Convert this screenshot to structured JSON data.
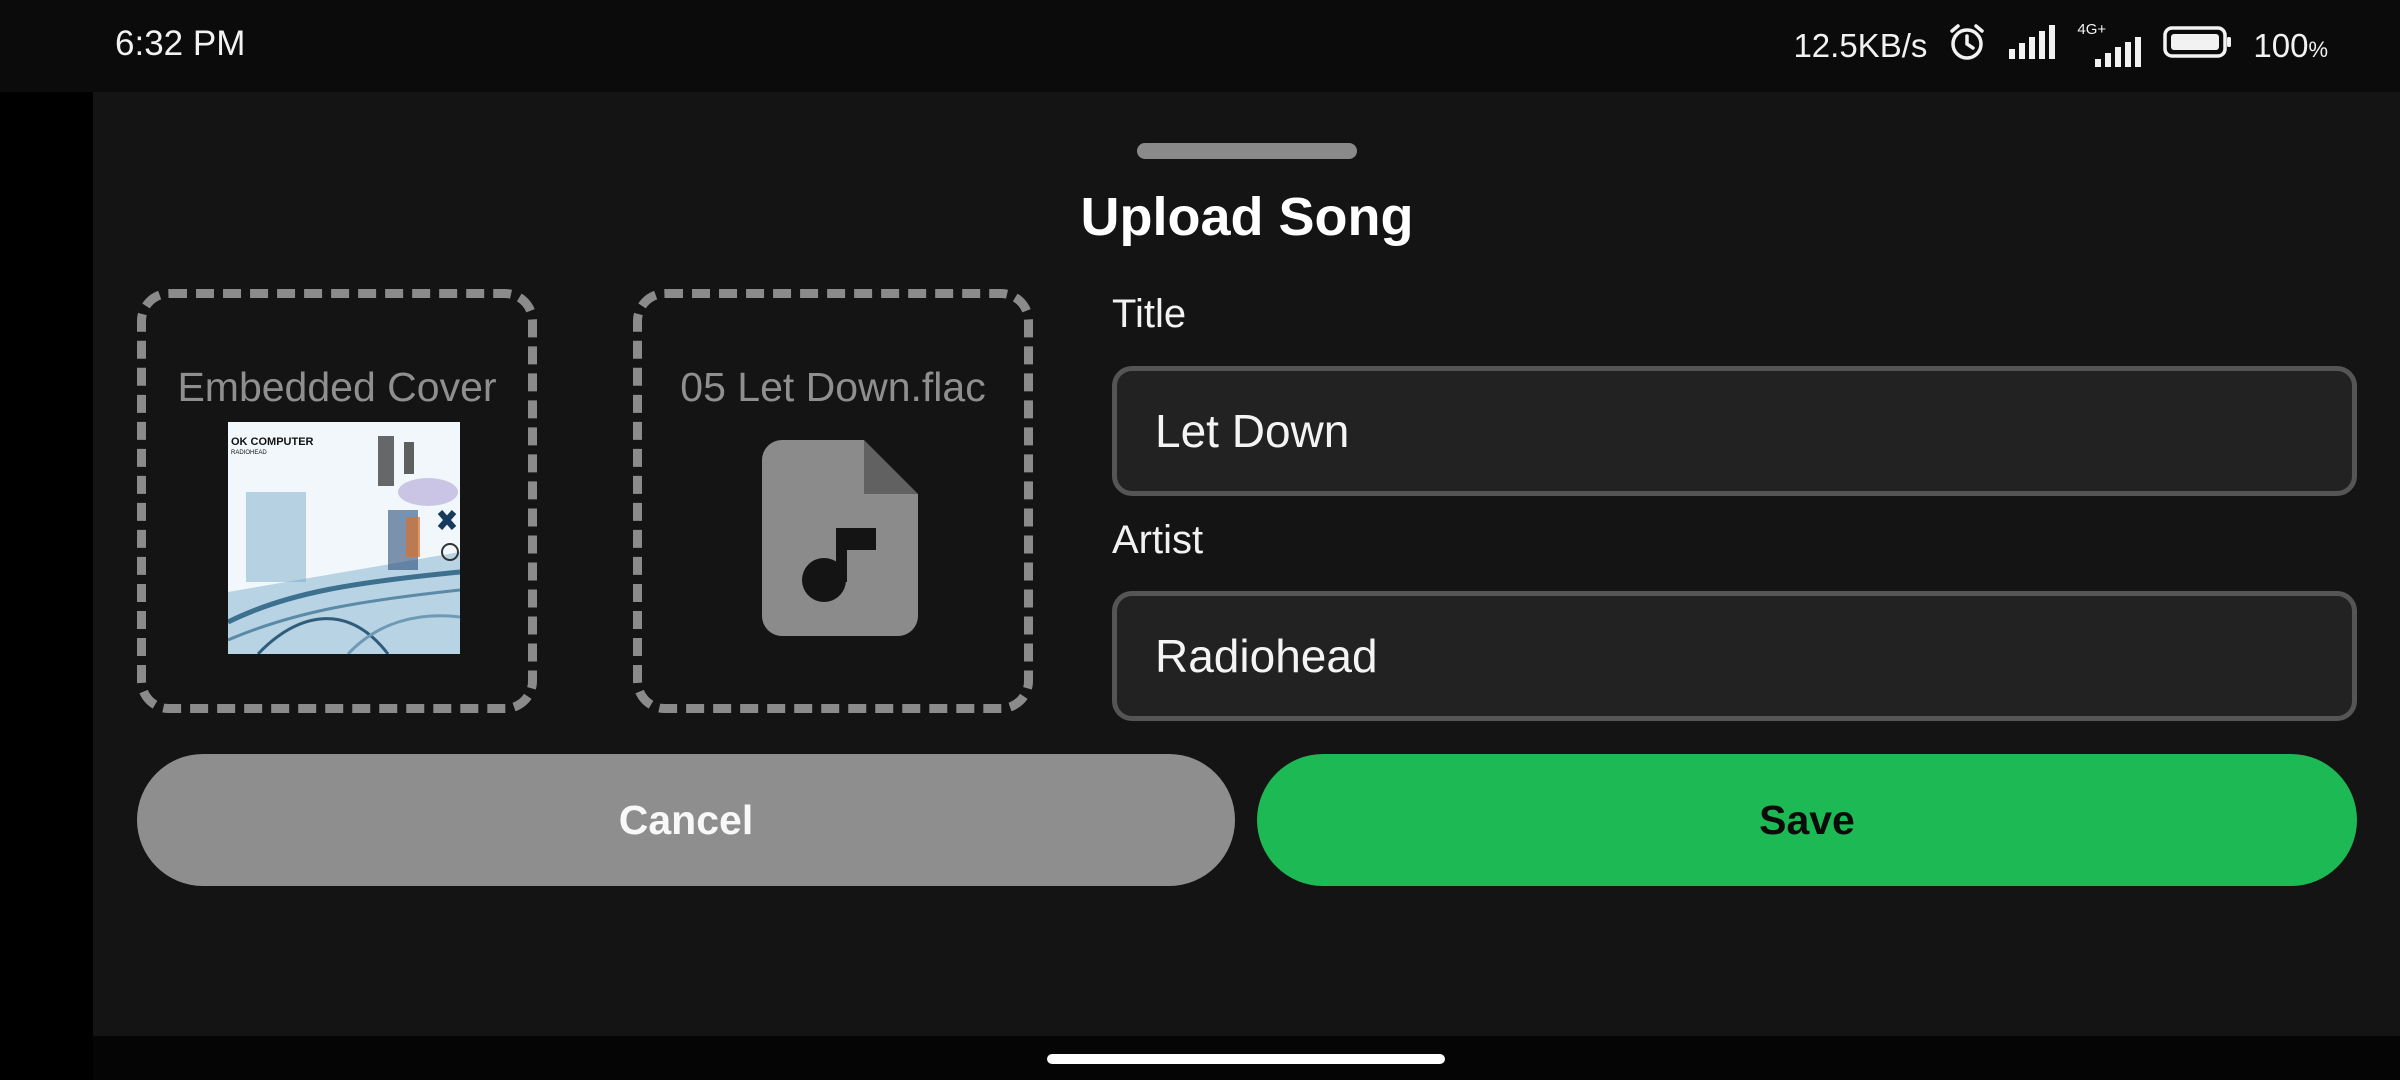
{
  "status_bar": {
    "time": "6:32 PM",
    "network_speed": "12.5KB/s",
    "network_type": "4G+",
    "battery": "100",
    "battery_unit": "%",
    "icons": [
      "alarm-icon",
      "signal-icon",
      "signal-4g-icon",
      "battery-icon"
    ]
  },
  "sheet": {
    "title": "Upload Song"
  },
  "cover_box": {
    "label": "Embedded Cover",
    "album_text": "OK COMPUTER",
    "album_subtext": "RADIOHEAD"
  },
  "file_box": {
    "label": "05 Let Down.flac",
    "icon": "audio-file-icon"
  },
  "form": {
    "title_label": "Title",
    "title_value": "Let Down",
    "artist_label": "Artist",
    "artist_value": "Radiohead"
  },
  "actions": {
    "cancel_label": "Cancel",
    "save_label": "Save"
  },
  "colors": {
    "accent": "#1db954",
    "sheet_background": "#141414",
    "cancel_button": "#8e8e8e"
  }
}
